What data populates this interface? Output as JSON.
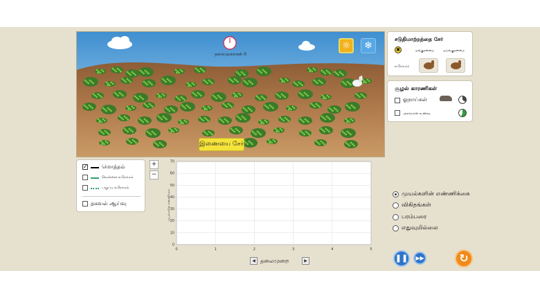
{
  "simulation": {
    "generation_label": "தலைமுறைகள் 0",
    "add_mate_label": "இணையை சேர்",
    "climate_buttons": [
      "sun",
      "snow"
    ]
  },
  "mutation_panel": {
    "title": "சடுதிமாற்றத்தை சேர்",
    "col_dominant": "ஓங்குதன்மை",
    "col_recessive": "ஒடுங்குதன்மை",
    "row_label": "உரோமம்"
  },
  "environment_panel": {
    "title": "சூழல் காரணிகள்",
    "wolves_label": "ஓநாய்கள்",
    "food_label": "அளவான உணவு"
  },
  "legend": {
    "total_label": "மொத்தம்",
    "white_fur_label": "வெள்ளை உரோமம்",
    "brown_fur_label": "பழுப்பு உரோமம்",
    "data_probe_label": "தகவல் ஆய்வு"
  },
  "zoom": {
    "in_label": "+",
    "out_label": "−"
  },
  "chart_data": {
    "type": "line",
    "x": [
      0,
      1,
      2,
      3,
      4,
      5
    ],
    "xlim": [
      0,
      5
    ],
    "ylim": [
      0,
      70
    ],
    "y_ticks": [
      0,
      10,
      20,
      30,
      40,
      50,
      60,
      70
    ],
    "x_ticks": [
      0,
      1,
      2,
      3,
      4,
      5
    ],
    "xlabel": "தலைமுறை",
    "ylabel": "முயல்களின் எண்ணிக்கை",
    "series": [],
    "grid": true
  },
  "view_options": [
    {
      "label": "முயல்களின் எண்ணிக்கை",
      "selected": true
    },
    {
      "label": "விகிதங்கள்",
      "selected": false
    },
    {
      "label": "பரம்பரை",
      "selected": false
    },
    {
      "label": "எதுவுமில்லை",
      "selected": false
    }
  ],
  "colors": {
    "sky": "#5aa3d8",
    "ground": "#a9764a",
    "total_line": "#000000",
    "white_fur_line": "#2aa36b",
    "brown_fur_line": "#2aa36b",
    "play_button": "#2f74c9",
    "reset_button": "#f08a1a"
  }
}
